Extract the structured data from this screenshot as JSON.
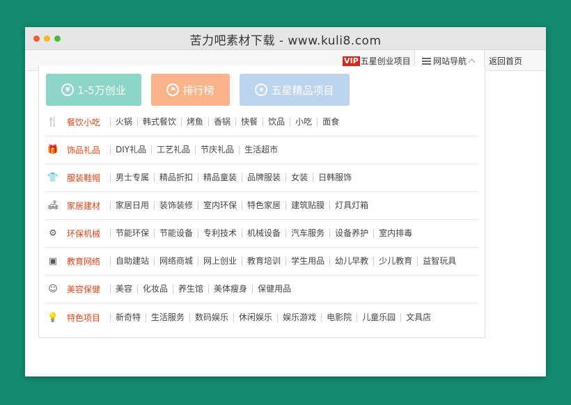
{
  "window": {
    "title": "苦力吧素材下载 - www.kuli8.com"
  },
  "topbar": {
    "vip_badge": "VIP",
    "vip_label": "五星创业项目",
    "nav_label": "网站导航",
    "home_label": "返回首页"
  },
  "buttons": [
    {
      "label": "1-5万创业",
      "icon": "yen-icon",
      "glyph": "¥",
      "color": "#8dd5c6"
    },
    {
      "label": "排行榜",
      "icon": "flag-icon",
      "glyph": "⚑",
      "color": "#fbb48a"
    },
    {
      "label": "五星精品项目",
      "icon": "star-icon",
      "glyph": "★",
      "color": "#bdd4ef"
    }
  ],
  "categories": [
    {
      "name": "餐饮小吃",
      "icon": "utensils-icon",
      "glyph": "🍴",
      "items": [
        "火锅",
        "韩式餐饮",
        "烤鱼",
        "香锅",
        "快餐",
        "饮品",
        "小吃",
        "面食"
      ]
    },
    {
      "name": "饰品礼品",
      "icon": "gift-icon",
      "glyph": "🎁",
      "items": [
        "DIY礼品",
        "工艺礼品",
        "节庆礼品",
        "生活超市"
      ]
    },
    {
      "name": "服装鞋帽",
      "icon": "shirt-icon",
      "glyph": "👕",
      "items": [
        "男士专属",
        "精品折扣",
        "精品童装",
        "品牌服装",
        "女装",
        "日韩服饰"
      ]
    },
    {
      "name": "家居建材",
      "icon": "sofa-icon",
      "glyph": "🛋",
      "items": [
        "家居日用",
        "装饰装修",
        "室内环保",
        "特色家居",
        "建筑贴膜",
        "灯具灯箱"
      ]
    },
    {
      "name": "环保机械",
      "icon": "machine-icon",
      "glyph": "⚙",
      "items": [
        "节能环保",
        "节能设备",
        "专利技术",
        "机械设备",
        "汽车服务",
        "设备养护",
        "室内排毒"
      ]
    },
    {
      "name": "教育网络",
      "icon": "education-icon",
      "glyph": "▣",
      "items": [
        "自助建站",
        "网络商城",
        "网上创业",
        "教育培训",
        "学生用品",
        "幼儿早教",
        "少儿教育",
        "益智玩具"
      ]
    },
    {
      "name": "美容保健",
      "icon": "beauty-icon",
      "glyph": "☺",
      "items": [
        "美容",
        "化妆品",
        "养生馆",
        "美体瘦身",
        "保健用品"
      ]
    },
    {
      "name": "特色项目",
      "icon": "bulb-icon",
      "glyph": "💡",
      "items": [
        "新奇特",
        "生活服务",
        "数码娱乐",
        "休闲娱乐",
        "娱乐游戏",
        "电影院",
        "儿童乐园",
        "文具店"
      ]
    }
  ]
}
